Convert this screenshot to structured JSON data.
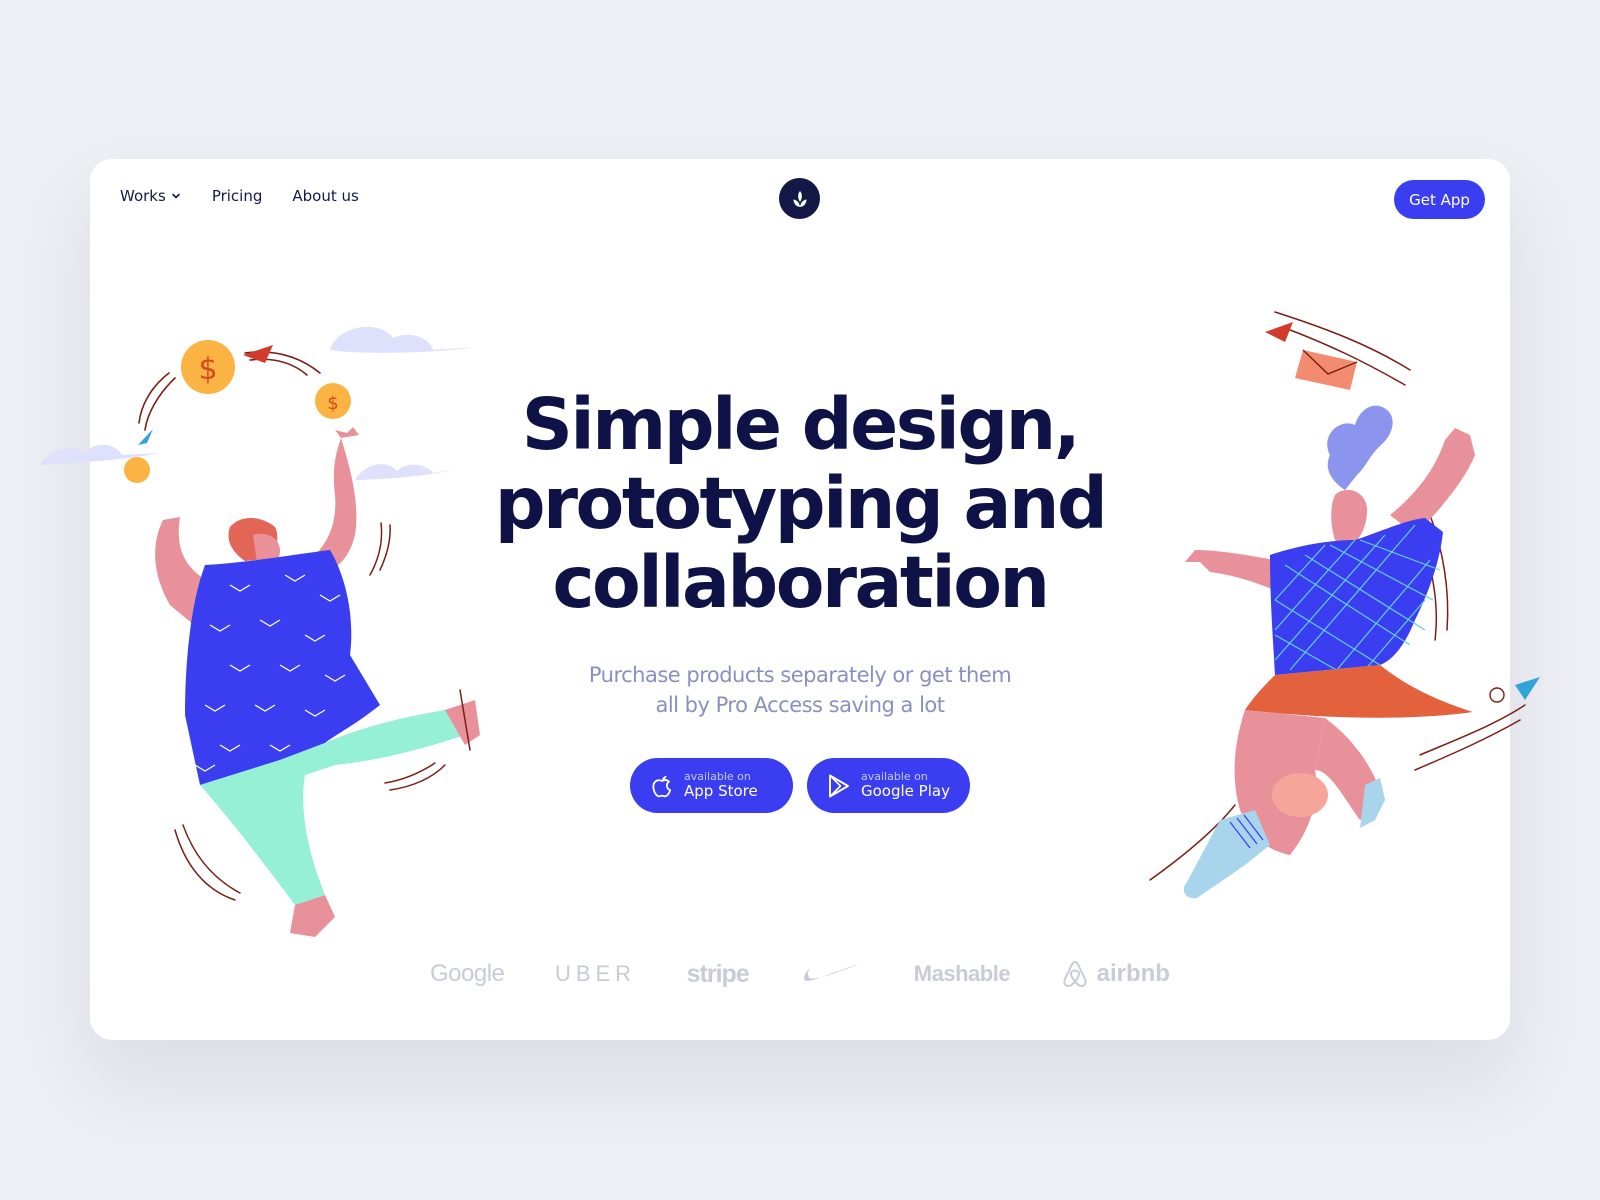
{
  "nav": {
    "items": [
      {
        "label": "Works",
        "has_dropdown": true
      },
      {
        "label": "Pricing"
      },
      {
        "label": "About us"
      }
    ],
    "logo_icon": "leaf-icon",
    "cta_label": "Get App"
  },
  "hero": {
    "title_lines": [
      "Simple design,",
      "prototyping and",
      "collaboration"
    ],
    "subtitle_lines": [
      "Purchase products separately or get them",
      "all by Pro Access saving a lot"
    ]
  },
  "store_buttons": [
    {
      "small": "available on",
      "big": "App Store",
      "icon": "apple-icon"
    },
    {
      "small": "available on",
      "big": "Google Play",
      "icon": "play-store-icon"
    }
  ],
  "brands": [
    "Google",
    "UBER",
    "stripe",
    "Nike",
    "Mashable",
    "airbnb"
  ],
  "colors": {
    "accent": "#3a3ef0",
    "heading": "#0f1247",
    "subtitle": "#8a8fc2",
    "brand_gray": "#c9cbd8",
    "background": "#eeeff4"
  }
}
